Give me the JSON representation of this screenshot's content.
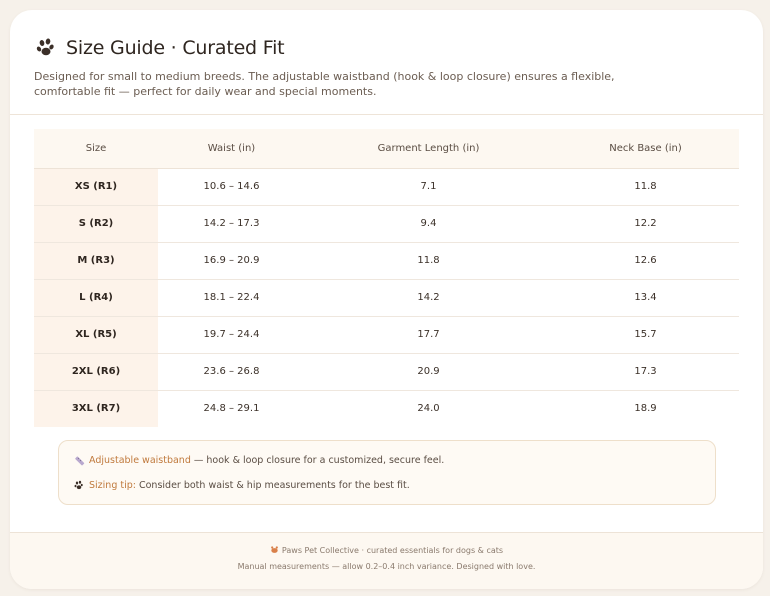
{
  "header": {
    "title": "Size Guide · Curated Fit",
    "subtitle": "Designed for small to medium breeds. The adjustable waistband (hook & loop closure) ensures a flexible, comfortable fit — perfect for daily wear and special moments.",
    "title_icon": "paw-icon"
  },
  "table": {
    "columns": [
      "Size",
      "Waist (in)",
      "Garment Length (in)",
      "Neck Base (in)"
    ],
    "rows": [
      {
        "size": "XS (R1)",
        "waist": "10.6 – 14.6",
        "length": "7.1",
        "neck": "11.8"
      },
      {
        "size": "S (R2)",
        "waist": "14.2 – 17.3",
        "length": "9.4",
        "neck": "12.2"
      },
      {
        "size": "M (R3)",
        "waist": "16.9 – 20.9",
        "length": "11.8",
        "neck": "12.6"
      },
      {
        "size": "L (R4)",
        "waist": "18.1 – 22.4",
        "length": "14.2",
        "neck": "13.4"
      },
      {
        "size": "XL (R5)",
        "waist": "19.7 – 24.4",
        "length": "17.7",
        "neck": "15.7"
      },
      {
        "size": "2XL (R6)",
        "waist": "23.6 – 26.8",
        "length": "20.9",
        "neck": "17.3"
      },
      {
        "size": "3XL (R7)",
        "waist": "24.8 – 29.1",
        "length": "24.0",
        "neck": "18.9"
      }
    ]
  },
  "notes": {
    "waistband_label": "Adjustable waistband",
    "waistband_text": " — hook & loop closure for a customized, secure feel.",
    "tip_label": "Sizing tip:",
    "tip_text": " Consider both waist & hip measurements for the best fit.",
    "waistband_icon": "ruler-icon",
    "tip_icon": "paw-icon"
  },
  "footer": {
    "line1": "Paws Pet Collective · curated essentials for dogs & cats",
    "line2": "Manual measurements — allow 0.2–0.4 inch variance. Designed with love.",
    "footer_icon": "pet-icon"
  },
  "colors": {
    "accent": "#c07a3d",
    "paw": "#3b2f28",
    "size_column_bg": "#fdf3ea"
  }
}
